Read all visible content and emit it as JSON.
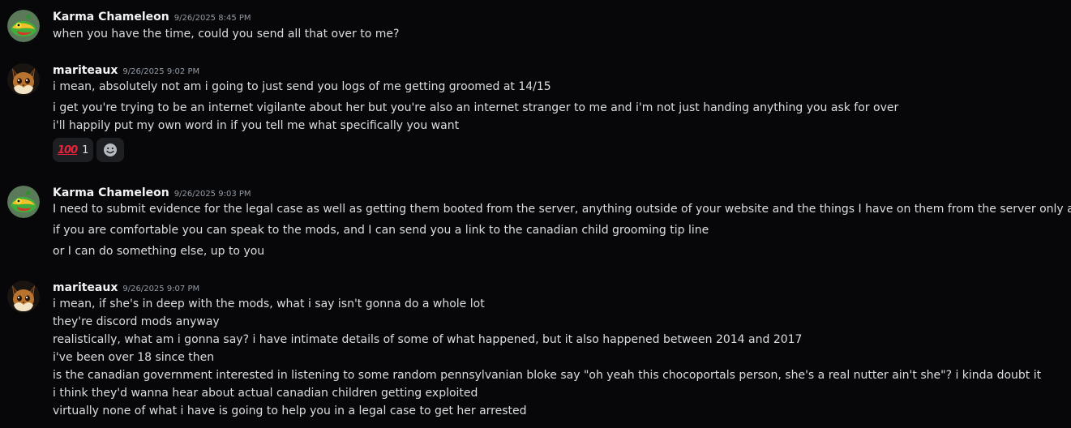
{
  "messages": [
    {
      "author": "Karma Chameleon",
      "avatar": "chameleon-avatar-icon",
      "timestamp": "9/26/2025 8:45 PM",
      "lines": [
        "when you have the time, could you send all that over to me?"
      ]
    },
    {
      "author": "mariteaux",
      "avatar": "eevee-avatar-icon",
      "timestamp": "9/26/2025 9:02 PM",
      "lines": [
        "i mean, absolutely not am i going to just send you logs of me getting groomed at 14/15",
        "i get you're trying to be an internet vigilante about her but you're also an internet stranger to me and i'm not just handing anything you ask for over",
        "i'll happily put my own word in if you tell me what specifically you want"
      ],
      "reactions": [
        {
          "emoji": "💯",
          "emoji_text": "100",
          "count": "1"
        }
      ]
    },
    {
      "author": "Karma Chameleon",
      "avatar": "chameleon-avatar-icon",
      "timestamp": "9/26/2025 9:03 PM",
      "lines": [
        "I need to submit evidence for the legal case as well as getting them booted from the server, anything outside of your website and the things I have on them from the server only aids me",
        "if you are comfortable you can speak to the mods, and I can send you a link to the canadian child grooming tip line",
        "or I can do something else, up to you"
      ]
    },
    {
      "author": "mariteaux",
      "avatar": "eevee-avatar-icon",
      "timestamp": "9/26/2025 9:07 PM",
      "lines": [
        "i mean, if she's in deep with the mods, what i say isn't gonna do a whole lot",
        "they're discord mods anyway",
        "realistically, what am i gonna say? i have intimate details of some of what happened, but it also happened between 2014 and 2017",
        "i've been over 18 since then",
        "is the canadian government interested in listening to some random pennsylvanian bloke say \"oh yeah this chocoportals person, she's a real nutter ain't she\"? i kinda doubt it",
        "i think they'd wanna hear about actual canadian children getting exploited",
        "virtually none of what i have is going to help you in a legal case to get her arrested"
      ]
    }
  ],
  "colors": {
    "background": "#070709",
    "text": "#dbdee1",
    "username": "#f2f3f5",
    "timestamp": "#949ba4",
    "reaction_bg": "#1e1f22"
  }
}
